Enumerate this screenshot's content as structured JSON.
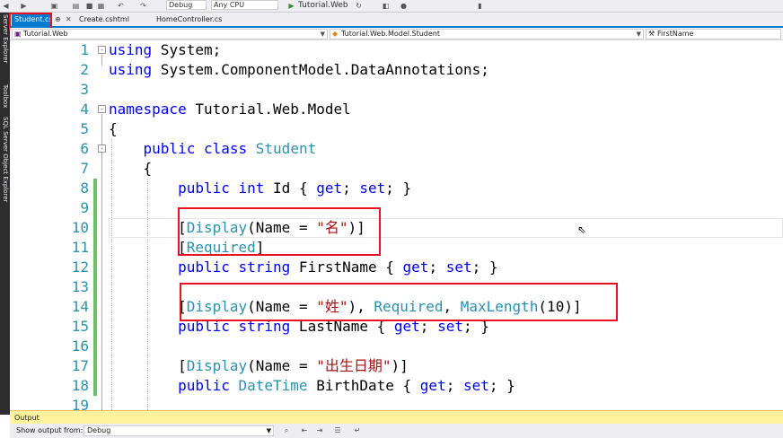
{
  "toolbar": {
    "config_value": "Debug",
    "platform_value": "Any CPU",
    "run_target": "Tutorial.Web",
    "icons": [
      "back-icon",
      "forward-icon",
      "new-project-icon",
      "open-icon",
      "save-icon",
      "save-all-icon",
      "undo-icon",
      "redo-icon",
      "run-icon",
      "refresh-icon",
      "browser-icon",
      "breakpoint-icon",
      "bookmark-icon"
    ]
  },
  "side_tabs": [
    "Server Explorer",
    "Toolbox",
    "SQL Server Object Explorer"
  ],
  "tabs": [
    {
      "label": "Student.cs",
      "active": true
    },
    {
      "label": "Create.cshtml",
      "active": false
    },
    {
      "label": "HomeController.cs",
      "active": false
    }
  ],
  "tab_pin_glyph": "⊕",
  "tab_close_glyph": "✕",
  "nav": {
    "project": "Tutorial.Web",
    "class_path": "Tutorial.Web.Model.Student",
    "member": "FirstName"
  },
  "code_lines": [
    {
      "num": "1",
      "fold": "-",
      "tokens": [
        {
          "t": "using",
          "c": "k"
        },
        {
          "t": " System;"
        }
      ]
    },
    {
      "num": "2",
      "tokens": [
        {
          "t": "using",
          "c": "k"
        },
        {
          "t": " System.ComponentModel.DataAnnotations;"
        }
      ]
    },
    {
      "num": "3",
      "tokens": []
    },
    {
      "num": "4",
      "fold": "-",
      "tokens": [
        {
          "t": "namespace",
          "c": "k"
        },
        {
          "t": " Tutorial.Web.Model"
        }
      ]
    },
    {
      "num": "5",
      "tokens": [
        {
          "t": "{"
        }
      ]
    },
    {
      "num": "6",
      "fold": "-",
      "tokens": [
        {
          "t": "    "
        },
        {
          "t": "public",
          "c": "k"
        },
        {
          "t": " "
        },
        {
          "t": "class",
          "c": "k"
        },
        {
          "t": " "
        },
        {
          "t": "Student",
          "c": "t"
        }
      ]
    },
    {
      "num": "7",
      "tokens": [
        {
          "t": "    {"
        }
      ]
    },
    {
      "num": "8",
      "changed": true,
      "tokens": [
        {
          "t": "        "
        },
        {
          "t": "public",
          "c": "k"
        },
        {
          "t": " "
        },
        {
          "t": "int",
          "c": "k"
        },
        {
          "t": " Id { "
        },
        {
          "t": "get",
          "c": "k"
        },
        {
          "t": "; "
        },
        {
          "t": "set",
          "c": "k"
        },
        {
          "t": "; }"
        }
      ]
    },
    {
      "num": "9",
      "changed": true,
      "tokens": []
    },
    {
      "num": "10",
      "changed": true,
      "highlight": true,
      "tokens": [
        {
          "t": "        ["
        },
        {
          "t": "Display",
          "c": "t"
        },
        {
          "t": "(Name = "
        },
        {
          "t": "\"名\"",
          "c": "s"
        },
        {
          "t": ")]"
        }
      ]
    },
    {
      "num": "11",
      "changed": true,
      "tokens": [
        {
          "t": "        ["
        },
        {
          "t": "Required",
          "c": "t"
        },
        {
          "t": "]"
        }
      ]
    },
    {
      "num": "12",
      "changed": true,
      "tokens": [
        {
          "t": "        "
        },
        {
          "t": "public",
          "c": "k"
        },
        {
          "t": " "
        },
        {
          "t": "string",
          "c": "k"
        },
        {
          "t": " FirstName { "
        },
        {
          "t": "get",
          "c": "k"
        },
        {
          "t": "; "
        },
        {
          "t": "set",
          "c": "k"
        },
        {
          "t": "; }"
        }
      ]
    },
    {
      "num": "13",
      "changed": true,
      "tokens": []
    },
    {
      "num": "14",
      "changed": true,
      "tokens": [
        {
          "t": "        ["
        },
        {
          "t": "Display",
          "c": "t"
        },
        {
          "t": "(Name = "
        },
        {
          "t": "\"姓\"",
          "c": "s"
        },
        {
          "t": "), "
        },
        {
          "t": "Required",
          "c": "t"
        },
        {
          "t": ", "
        },
        {
          "t": "MaxLength",
          "c": "t"
        },
        {
          "t": "(10)]"
        }
      ]
    },
    {
      "num": "15",
      "changed": true,
      "tokens": [
        {
          "t": "        "
        },
        {
          "t": "public",
          "c": "k"
        },
        {
          "t": " "
        },
        {
          "t": "string",
          "c": "k"
        },
        {
          "t": " LastName { "
        },
        {
          "t": "get",
          "c": "k"
        },
        {
          "t": "; "
        },
        {
          "t": "set",
          "c": "k"
        },
        {
          "t": "; }"
        }
      ]
    },
    {
      "num": "16",
      "changed": true,
      "tokens": []
    },
    {
      "num": "17",
      "changed": true,
      "tokens": [
        {
          "t": "        ["
        },
        {
          "t": "Display",
          "c": "t"
        },
        {
          "t": "(Name = "
        },
        {
          "t": "\"出生日期\"",
          "c": "s"
        },
        {
          "t": ")]"
        }
      ]
    },
    {
      "num": "18",
      "changed": true,
      "tokens": [
        {
          "t": "        "
        },
        {
          "t": "public",
          "c": "k"
        },
        {
          "t": " "
        },
        {
          "t": "DateTime",
          "c": "t"
        },
        {
          "t": " BirthDate { "
        },
        {
          "t": "get",
          "c": "k"
        },
        {
          "t": "; "
        },
        {
          "t": "set",
          "c": "k"
        },
        {
          "t": "; }"
        }
      ]
    },
    {
      "num": "19",
      "tokens": []
    }
  ],
  "colors": {
    "keyword": "#0000ff",
    "type": "#2b91af",
    "string": "#a31515",
    "accent": "#007acc",
    "annotation_box": "#e81123"
  },
  "output": {
    "title": "Output",
    "show_from_label": "Show output from:",
    "source_value": "Debug"
  }
}
